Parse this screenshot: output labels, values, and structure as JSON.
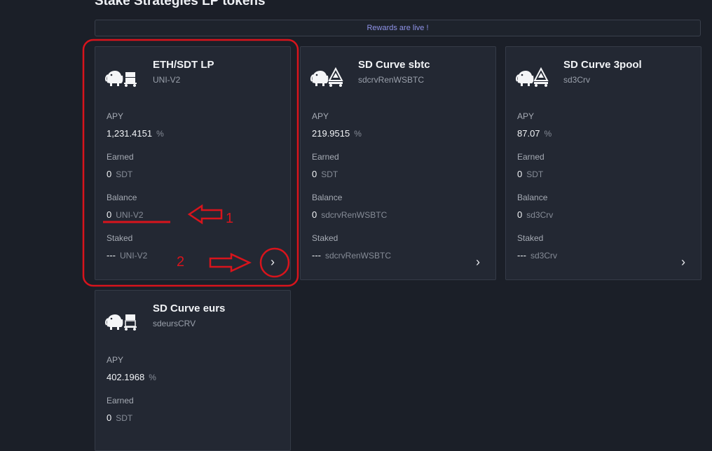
{
  "page": {
    "title": "Stake Strategies LP tokens",
    "banner": "Rewards are live !"
  },
  "labels": {
    "apy": "APY",
    "earned": "Earned",
    "balance": "Balance",
    "staked": "Staked",
    "percent": "%"
  },
  "icons": {
    "elephant": "elephant-icon",
    "chevron": "chevron-right-icon"
  },
  "colors": {
    "annotation": "#d8141c",
    "banner_text": "#8f93e8"
  },
  "cards": [
    {
      "name": "ETH/SDT LP",
      "symbol": "UNI-V2",
      "apy": "1,231.4151",
      "earned": "0",
      "earned_unit": "SDT",
      "balance": "0",
      "balance_unit": "UNI-V2",
      "staked": "---",
      "staked_unit": "UNI-V2"
    },
    {
      "name": "SD Curve sbtc",
      "symbol": "sdcrvRenWSBTC",
      "apy": "219.9515",
      "earned": "0",
      "earned_unit": "SDT",
      "balance": "0",
      "balance_unit": "sdcrvRenWSBTC",
      "staked": "---",
      "staked_unit": "sdcrvRenWSBTC"
    },
    {
      "name": "SD Curve 3pool",
      "symbol": "sd3Crv",
      "apy": "87.07",
      "earned": "0",
      "earned_unit": "SDT",
      "balance": "0",
      "balance_unit": "sd3Crv",
      "staked": "---",
      "staked_unit": "sd3Crv"
    },
    {
      "name": "SD Curve eurs",
      "symbol": "sdeursCRV",
      "apy": "402.1968",
      "earned": "0",
      "earned_unit": "SDT"
    }
  ],
  "annotations": {
    "label_1": "1",
    "label_2": "2"
  }
}
